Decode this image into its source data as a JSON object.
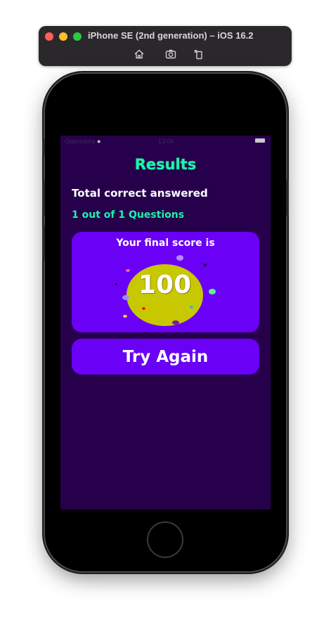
{
  "simulator": {
    "title": "iPhone SE (2nd generation) – iOS 16.2",
    "toolbar": [
      {
        "name": "home-icon"
      },
      {
        "name": "screenshot-icon"
      },
      {
        "name": "rotate-icon"
      }
    ]
  },
  "status_bar": {
    "carrier": "Operadora",
    "time": "13:06"
  },
  "results": {
    "title": "Results",
    "total_label": "Total correct answered",
    "questions_count": "1 out of 1 Questions",
    "final_score_label": "Your final score is",
    "final_score_value": "100",
    "try_again_label": "Try Again"
  },
  "colors": {
    "screen_background": "#27004c",
    "accent_green": "#1cf4a9",
    "card_purple": "#6a00f5",
    "score_blob": "#c8c800"
  }
}
